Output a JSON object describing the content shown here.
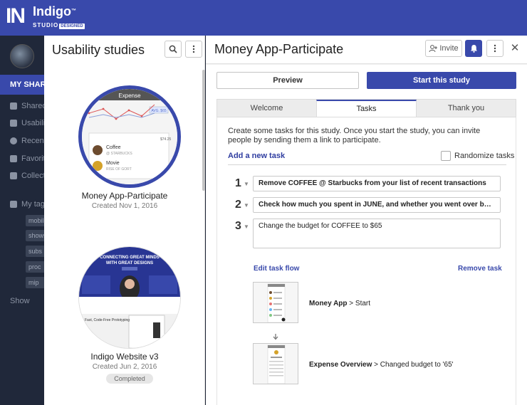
{
  "brand": {
    "name": "Indigo",
    "sub": "STUDIO",
    "tag": "DESIGNED",
    "mark": "IN",
    "accent": "#3949ab"
  },
  "nav": {
    "my_shared": "MY SHARED",
    "items": [
      {
        "label": "Shared",
        "icon": "cloud-icon"
      },
      {
        "label": "Usability studies",
        "icon": "clipboard-icon"
      },
      {
        "label": "Recent",
        "icon": "clock-icon"
      },
      {
        "label": "Favorites",
        "icon": "star-icon"
      },
      {
        "label": "Collections",
        "icon": "folder-icon"
      }
    ],
    "tags_label": "My tags",
    "tags": [
      "mobile",
      "shows",
      "subs",
      "proc",
      "mip"
    ],
    "show_more": "Show"
  },
  "studies": {
    "title": "Usability studies",
    "cards": [
      {
        "name": "Money App-Participate",
        "date": "Created Nov 1, 2016",
        "status": ""
      },
      {
        "name": "Indigo Website v3",
        "date": "Created Jun 2, 2016",
        "status": "Completed"
      }
    ],
    "thumb1": {
      "header": "Expense",
      "amount1": "$74.25",
      "item1": "Coffee",
      "item1_sub": "@ STARBUCKS",
      "item2": "Movie",
      "item2_sub": "RISE OF GORT",
      "avg": "AVG. $65"
    },
    "thumb2": {
      "headline1": "CONNECTING GREAT MINDS",
      "headline2": "WITH GREAT DESIGNS",
      "caption": "Fast, Code-Free Prototyping"
    }
  },
  "main": {
    "title": "Money App-Participate",
    "invite_label": "Invite",
    "preview_label": "Preview",
    "start_label": "Start this study",
    "tabs": [
      "Welcome",
      "Tasks",
      "Thank you"
    ],
    "active_tab": "Tasks",
    "intro": "Create some tasks for this study. Once you start the study, you can invite people by sending them a link to participate.",
    "add_task": "Add a new task",
    "randomize": "Randomize tasks",
    "tasks": [
      {
        "num": "1",
        "text": "Remove COFFEE @ Starbucks from your list of recent transactions"
      },
      {
        "num": "2",
        "text": "Check how much you spent in JUNE, and whether you went over bud..."
      },
      {
        "num": "3",
        "text": "Change the budget for COFFEE to $65"
      }
    ],
    "edit_flow": "Edit task flow",
    "remove_task": "Remove task",
    "flow": [
      {
        "screen": "Money App",
        "action": "Start"
      },
      {
        "screen": "Expense Overview",
        "action": "Changed budget to '65'"
      }
    ],
    "flow_separator": ">"
  }
}
